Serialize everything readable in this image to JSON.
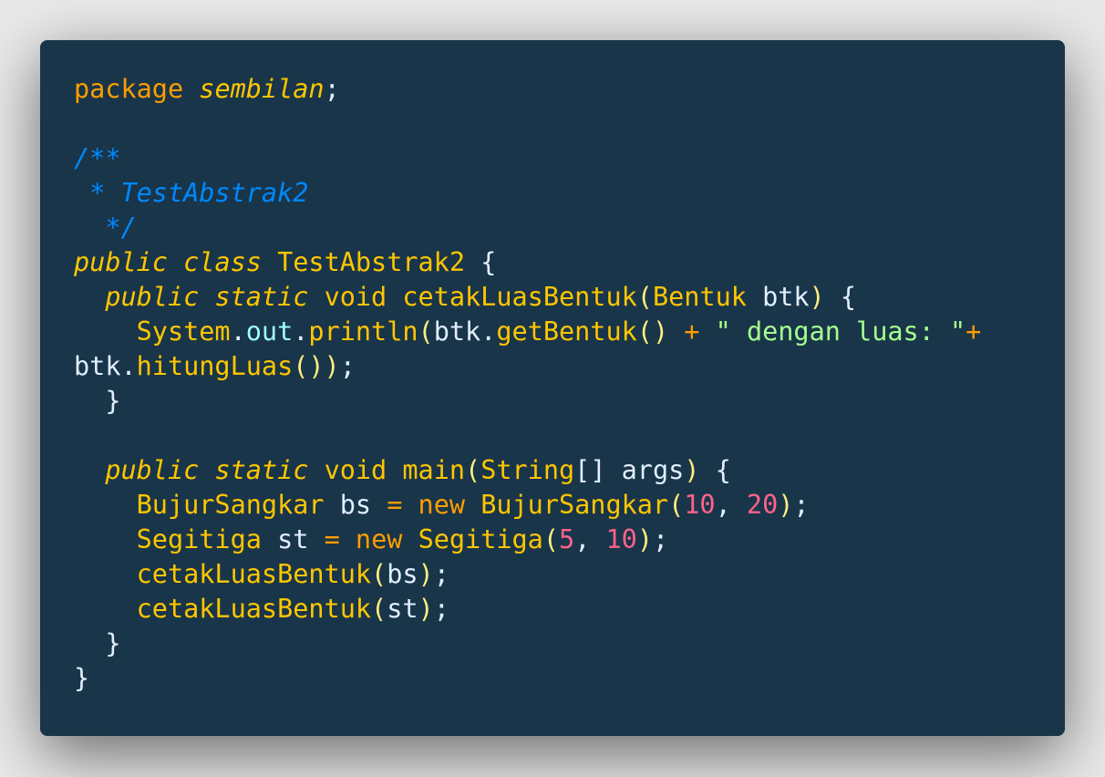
{
  "language": "java",
  "colors": {
    "background": "#193549",
    "keyword": "#ff9d00",
    "identifier": "#ffc600",
    "comment": "#0088ff",
    "string": "#a5ff90",
    "number": "#ff628c",
    "property": "#9effff",
    "plain": "#e1efff"
  },
  "code_lines": [
    [
      [
        "package",
        "kw"
      ],
      [
        " ",
        "pl"
      ],
      [
        "sembilan",
        "pkg"
      ],
      [
        ";",
        "pl"
      ]
    ],
    [],
    [
      [
        "/**",
        "cm"
      ]
    ],
    [
      [
        " * TestAbstrak2",
        "cm"
      ]
    ],
    [
      [
        "  */",
        "cm"
      ]
    ],
    [
      [
        "public",
        "kwi"
      ],
      [
        " ",
        "pl"
      ],
      [
        "class",
        "kwi"
      ],
      [
        " ",
        "pl"
      ],
      [
        "TestAbstrak2",
        "cls"
      ],
      [
        " {",
        "pl"
      ]
    ],
    [
      [
        "  ",
        "pl"
      ],
      [
        "public",
        "kwi"
      ],
      [
        " ",
        "pl"
      ],
      [
        "static",
        "kwi"
      ],
      [
        " ",
        "pl"
      ],
      [
        "void",
        "cls"
      ],
      [
        " ",
        "pl"
      ],
      [
        "cetakLuasBentuk",
        "fn"
      ],
      [
        "(",
        "pr"
      ],
      [
        "Bentuk",
        "cls"
      ],
      [
        " btk",
        "pl"
      ],
      [
        ")",
        "pr"
      ],
      [
        " {",
        "pl"
      ]
    ],
    [
      [
        "    ",
        "pl"
      ],
      [
        "System",
        "cls"
      ],
      [
        ".",
        "pl"
      ],
      [
        "out",
        "prop"
      ],
      [
        ".",
        "pl"
      ],
      [
        "println",
        "fn"
      ],
      [
        "(",
        "pr"
      ],
      [
        "btk.",
        "pl"
      ],
      [
        "getBentuk",
        "fn"
      ],
      [
        "()",
        "pr"
      ],
      [
        " ",
        "pl"
      ],
      [
        "+",
        "op"
      ],
      [
        " ",
        "pl"
      ],
      [
        "\" dengan luas: \"",
        "str"
      ],
      [
        "+",
        "op"
      ]
    ],
    [
      [
        "btk.",
        "pl"
      ],
      [
        "hitungLuas",
        "fn"
      ],
      [
        "())",
        "pr"
      ],
      [
        ";",
        "pl"
      ]
    ],
    [
      [
        "  }",
        "pl"
      ]
    ],
    [],
    [
      [
        "  ",
        "pl"
      ],
      [
        "public",
        "kwi"
      ],
      [
        " ",
        "pl"
      ],
      [
        "static",
        "kwi"
      ],
      [
        " ",
        "pl"
      ],
      [
        "void",
        "cls"
      ],
      [
        " ",
        "pl"
      ],
      [
        "main",
        "fn"
      ],
      [
        "(",
        "pr"
      ],
      [
        "String",
        "cls"
      ],
      [
        "[] args",
        "pl"
      ],
      [
        ")",
        "pr"
      ],
      [
        " {",
        "pl"
      ]
    ],
    [
      [
        "    ",
        "pl"
      ],
      [
        "BujurSangkar",
        "cls"
      ],
      [
        " bs ",
        "pl"
      ],
      [
        "=",
        "op"
      ],
      [
        " ",
        "pl"
      ],
      [
        "new",
        "kw"
      ],
      [
        " ",
        "pl"
      ],
      [
        "BujurSangkar",
        "fn"
      ],
      [
        "(",
        "pr"
      ],
      [
        "10",
        "num"
      ],
      [
        ", ",
        "pl"
      ],
      [
        "20",
        "num"
      ],
      [
        ")",
        "pr"
      ],
      [
        ";",
        "pl"
      ]
    ],
    [
      [
        "    ",
        "pl"
      ],
      [
        "Segitiga",
        "cls"
      ],
      [
        " st ",
        "pl"
      ],
      [
        "=",
        "op"
      ],
      [
        " ",
        "pl"
      ],
      [
        "new",
        "kw"
      ],
      [
        " ",
        "pl"
      ],
      [
        "Segitiga",
        "fn"
      ],
      [
        "(",
        "pr"
      ],
      [
        "5",
        "num"
      ],
      [
        ", ",
        "pl"
      ],
      [
        "10",
        "num"
      ],
      [
        ")",
        "pr"
      ],
      [
        ";",
        "pl"
      ]
    ],
    [
      [
        "    ",
        "pl"
      ],
      [
        "cetakLuasBentuk",
        "fn"
      ],
      [
        "(",
        "pr"
      ],
      [
        "bs",
        "pl"
      ],
      [
        ")",
        "pr"
      ],
      [
        ";",
        "pl"
      ]
    ],
    [
      [
        "    ",
        "pl"
      ],
      [
        "cetakLuasBentuk",
        "fn"
      ],
      [
        "(",
        "pr"
      ],
      [
        "st",
        "pl"
      ],
      [
        ")",
        "pr"
      ],
      [
        ";",
        "pl"
      ]
    ],
    [
      [
        "  }",
        "pl"
      ]
    ],
    [
      [
        "}",
        "pl"
      ]
    ]
  ]
}
